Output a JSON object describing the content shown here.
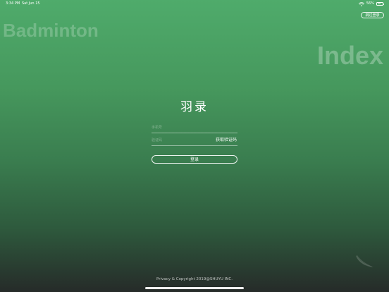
{
  "status_bar": {
    "time": "3:34 PM",
    "date": "Sat Jun 15",
    "battery_percent": "56%",
    "battery_level": 0.56,
    "wifi_icon": "wifi-icon",
    "battery_icon": "battery-icon"
  },
  "header": {
    "skip_label": "跳过登录"
  },
  "background": {
    "word_left": "Badminton",
    "word_right": "Index"
  },
  "app": {
    "title": "羽录"
  },
  "form": {
    "phone_placeholder": "手机号",
    "code_placeholder": "验证码",
    "get_code_label": "获取验证码",
    "login_label": "登录"
  },
  "footer": {
    "copyright": "Privacy & Copyright 2019@SHUYU INC."
  },
  "colors": {
    "gradient_top": "#4fab6b",
    "gradient_bottom": "#262b29",
    "text": "#ffffff"
  }
}
